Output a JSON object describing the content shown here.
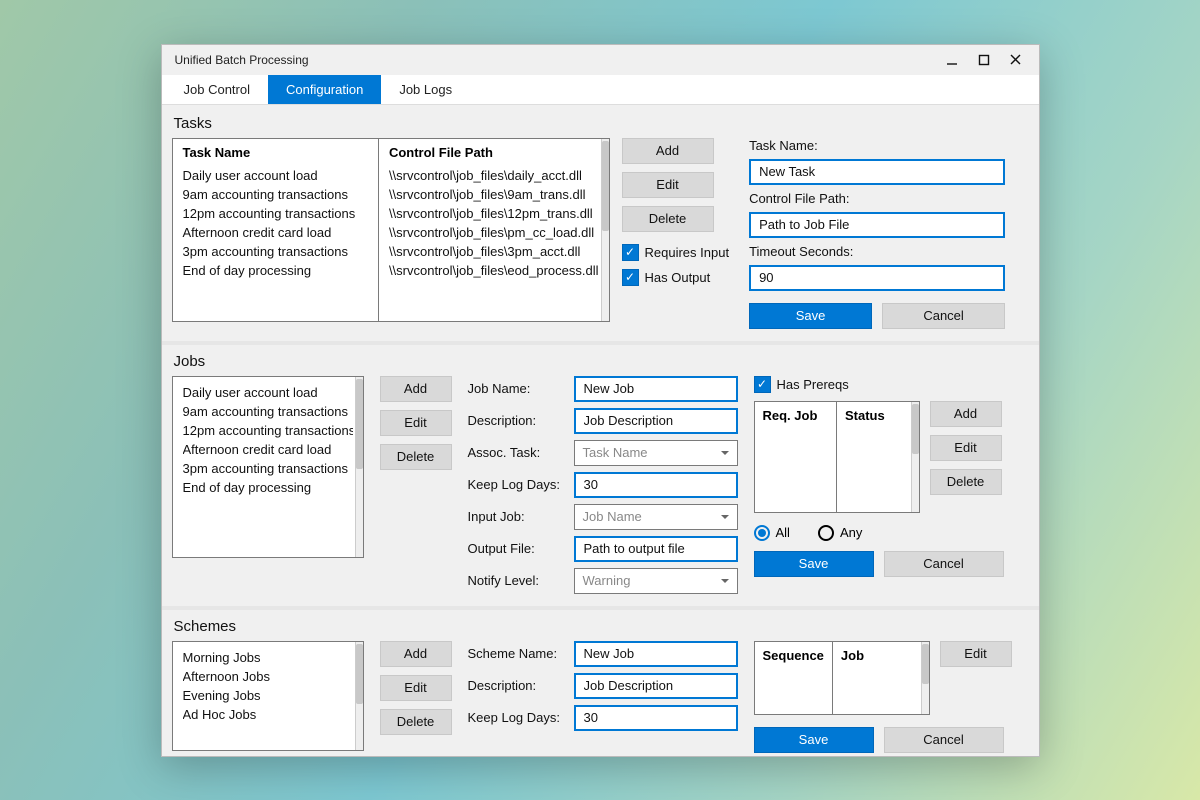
{
  "window": {
    "title": "Unified Batch Processing"
  },
  "tabs": {
    "job_control": "Job Control",
    "configuration": "Configuration",
    "job_logs": "Job Logs"
  },
  "sections": {
    "tasks": "Tasks",
    "jobs": "Jobs",
    "schemes": "Schemes"
  },
  "task_table": {
    "hdr_name": "Task Name",
    "hdr_path": "Control File Path",
    "rows": [
      {
        "name": "Daily user account load",
        "path": "\\\\srvcontrol\\job_files\\daily_acct.dll"
      },
      {
        "name": "9am accounting transactions",
        "path": "\\\\srvcontrol\\job_files\\9am_trans.dll"
      },
      {
        "name": "12pm accounting transactions",
        "path": "\\\\srvcontrol\\job_files\\12pm_trans.dll"
      },
      {
        "name": "Afternoon credit card load",
        "path": "\\\\srvcontrol\\job_files\\pm_cc_load.dll"
      },
      {
        "name": "3pm accounting transactions",
        "path": "\\\\srvcontrol\\job_files\\3pm_acct.dll"
      },
      {
        "name": "End of day processing",
        "path": "\\\\srvcontrol\\job_files\\eod_process.dll"
      }
    ]
  },
  "buttons": {
    "add": "Add",
    "edit": "Edit",
    "delete": "Delete",
    "save": "Save",
    "cancel": "Cancel"
  },
  "task_checks": {
    "requires_input": "Requires Input",
    "has_output": "Has Output"
  },
  "task_form": {
    "name_lbl": "Task Name:",
    "name_val": "New Task",
    "path_lbl": "Control File Path:",
    "path_val": "Path to Job File",
    "timeout_lbl": "Timeout Seconds:",
    "timeout_val": "90"
  },
  "job_list": [
    "Daily user account load",
    "9am accounting transactions",
    "12pm accounting transactions",
    "Afternoon credit card load",
    "3pm accounting transactions",
    "End of day processing"
  ],
  "job_form": {
    "name_lbl": "Job Name:",
    "name_val": "New Job",
    "desc_lbl": "Description:",
    "desc_val": "Job Description",
    "task_lbl": "Assoc. Task:",
    "task_val": "Task Name",
    "days_lbl": "Keep Log Days:",
    "days_val": "30",
    "input_lbl": "Input Job:",
    "input_val": "Job Name",
    "output_lbl": "Output File:",
    "output_val": "Path to output file",
    "notify_lbl": "Notify Level:",
    "notify_val": "Warning"
  },
  "prereq": {
    "has_prereqs": "Has Prereqs",
    "hdr_req": "Req. Job",
    "hdr_status": "Status",
    "all": "All",
    "any": "Any"
  },
  "scheme_list": [
    "Morning Jobs",
    "Afternoon Jobs",
    "Evening Jobs",
    "Ad Hoc Jobs"
  ],
  "scheme_form": {
    "name_lbl": "Scheme Name:",
    "name_val": "New Job",
    "desc_lbl": "Description:",
    "desc_val": "Job Description",
    "days_lbl": "Keep Log Days:",
    "days_val": "30"
  },
  "seq_table": {
    "hdr_seq": "Sequence",
    "hdr_job": "Job"
  }
}
